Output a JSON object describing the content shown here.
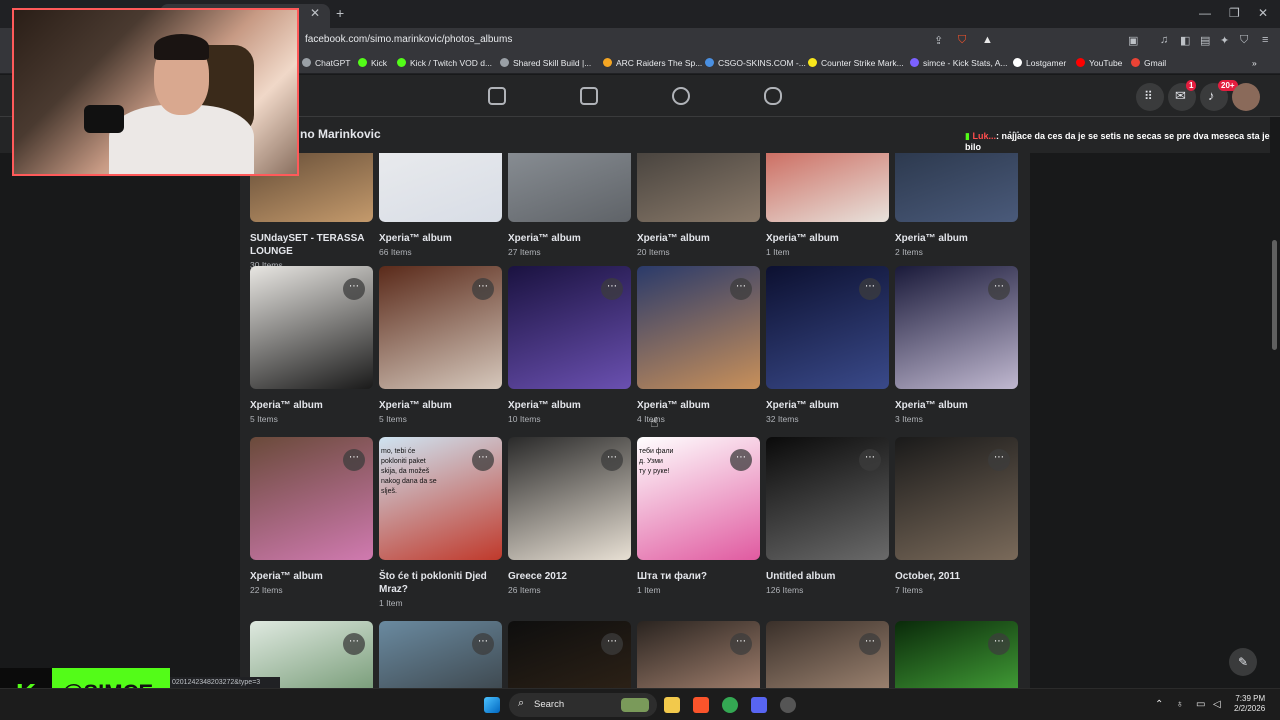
{
  "browser": {
    "url": "facebook.com/simo.marinkovic/photos_albums",
    "bookmarks": [
      "ChatGPT",
      "Kick",
      "Kick / Twitch VOD d...",
      "Shared Skill Build |...",
      "ARC Raiders The Sp...",
      "CSGO-SKINS.COM -...",
      "Counter Strike Mark...",
      "simce - Kick Stats, A...",
      "Lostgamer",
      "YouTube",
      "Gmail"
    ],
    "status_url": "0201242348203272&type=3"
  },
  "facebook": {
    "owner_name": "no Marinkovic",
    "messenger_badge": "1",
    "notif_badge": "20+"
  },
  "albums": [
    {
      "name": "SUNdaySET - TERASSA LOUNGE",
      "count": "30 Items",
      "colors": [
        "#3a2a1f",
        "#c49a6c"
      ]
    },
    {
      "name": "Xperia™ album",
      "count": "66 Items",
      "colors": [
        "#f0f0f0",
        "#d8dde6"
      ]
    },
    {
      "name": "Xperia™ album",
      "count": "27 Items",
      "colors": [
        "#9aa0a6",
        "#5f6368"
      ]
    },
    {
      "name": "Xperia™ album",
      "count": "20 Items",
      "colors": [
        "#2b2b2b",
        "#8a7a6a"
      ]
    },
    {
      "name": "Xperia™ album",
      "count": "1 Item",
      "colors": [
        "#c0392b",
        "#e8e2dc"
      ]
    },
    {
      "name": "Xperia™ album",
      "count": "2 Items",
      "colors": [
        "#1f2a3a",
        "#4a5a7a"
      ]
    },
    {
      "name": "Xperia™ album",
      "count": "5 Items",
      "colors": [
        "#e8e6e2",
        "#1a1a1a"
      ]
    },
    {
      "name": "Xperia™ album",
      "count": "5 Items",
      "colors": [
        "#5a2a1a",
        "#d6c8bc"
      ]
    },
    {
      "name": "Xperia™ album",
      "count": "10 Items",
      "colors": [
        "#1a1240",
        "#6a50b0"
      ]
    },
    {
      "name": "Xperia™ album",
      "count": "4 Items",
      "colors": [
        "#2a3a6a",
        "#c8905a"
      ]
    },
    {
      "name": "Xperia™ album",
      "count": "32 Items",
      "colors": [
        "#0c1030",
        "#3a4a8a"
      ]
    },
    {
      "name": "Xperia™ album",
      "count": "3 Items",
      "colors": [
        "#1a1a3a",
        "#c0b8d0"
      ]
    },
    {
      "name": "Xperia™ album",
      "count": "22 Items",
      "colors": [
        "#6a4a3a",
        "#d07ab0"
      ]
    },
    {
      "name": "Što će ti pokloniti Djed Mraz?",
      "count": "1 Item",
      "colors": [
        "#cfe4f2",
        "#c0392b"
      ]
    },
    {
      "name": "Greece 2012",
      "count": "26 Items",
      "colors": [
        "#2a2a2a",
        "#e8e0d4"
      ]
    },
    {
      "name": "Шта ти фали?",
      "count": "1 Item",
      "colors": [
        "#ffffff",
        "#e05aa0"
      ]
    },
    {
      "name": "Untitled album",
      "count": "126 Items",
      "colors": [
        "#0a0a0a",
        "#6a6a6a"
      ]
    },
    {
      "name": "October, 2011",
      "count": "7 Items",
      "colors": [
        "#1a1a1a",
        "#7a6a5a"
      ]
    },
    {
      "name": "",
      "count": "",
      "colors": [
        "#dfe9e0",
        "#4a7a4a"
      ]
    },
    {
      "name": "",
      "count": "",
      "colors": [
        "#6a8aa0",
        "#2a2a2a"
      ]
    },
    {
      "name": "",
      "count": "",
      "colors": [
        "#0e0e0e",
        "#3a2a1a"
      ]
    },
    {
      "name": "",
      "count": "",
      "colors": [
        "#2a2420",
        "#d6a890"
      ]
    },
    {
      "name": "",
      "count": "",
      "colors": [
        "#3a302a",
        "#c8a890"
      ]
    },
    {
      "name": "",
      "count": "",
      "colors": [
        "#0a2a0a",
        "#5ad04a"
      ]
    }
  ],
  "thumb_texts": {
    "t1": "mo, tebi će\npokloniti paket\nskija, da možeš\nnakog dana da se\nslješ.",
    "t2": "теби фали\nд. Узми\nту у руке!"
  },
  "chat": {
    "user": "Luk...",
    "message": ": najjace da ces da je se setis ne secas se pre dva meseca sta je bilo"
  },
  "overlay": {
    "handle": "@SIMCE"
  },
  "taskbar": {
    "search_label": "Search",
    "time": "7:39 PM",
    "date": "2/2/2026"
  }
}
